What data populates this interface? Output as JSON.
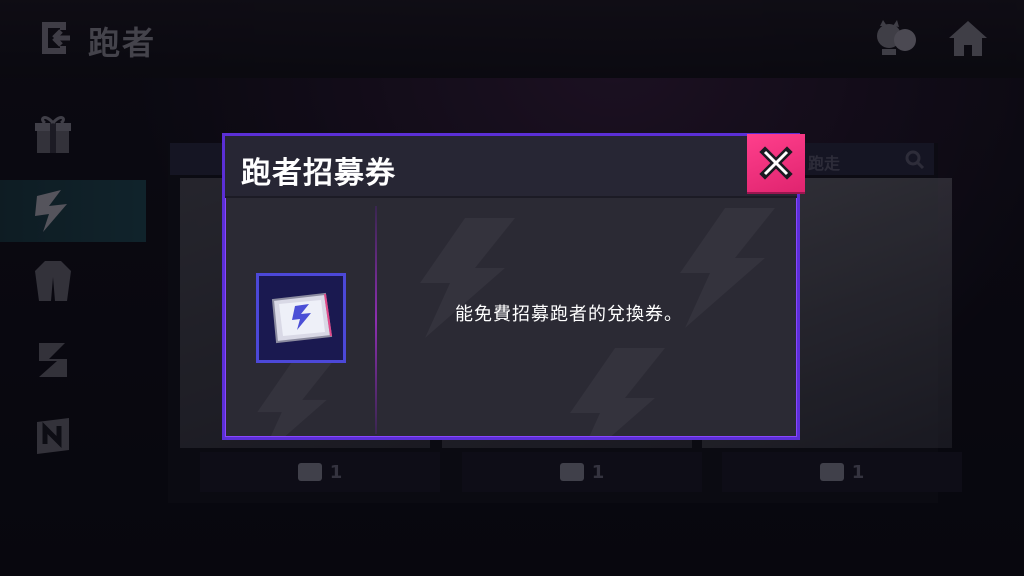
{
  "header": {
    "title": "跑者",
    "back_icon": "back-arrow-icon",
    "friends_icon": "friends-icon",
    "home_icon": "home-icon"
  },
  "sidebar": {
    "items": [
      {
        "icon": "gift-icon",
        "active": false
      },
      {
        "icon": "runner-icon",
        "active": true
      },
      {
        "icon": "outfit-icon",
        "active": false
      },
      {
        "icon": "spray-icon",
        "active": false
      },
      {
        "icon": "n-badge-icon",
        "active": false
      }
    ]
  },
  "background": {
    "panel_label": "跑走",
    "cards": [
      {
        "count": "1"
      },
      {
        "count": "1"
      },
      {
        "count": "1"
      }
    ]
  },
  "modal": {
    "title": "跑者招募券",
    "close_icon": "close-icon",
    "item_icon": "recruit-ticket-icon",
    "description": "能免費招募跑者的兌換券。"
  },
  "colors": {
    "accent_pink": "#e92a79",
    "border_purple": "#5b2fd6",
    "slot_blue": "#1a1950",
    "active_teal": "#1b3b44"
  }
}
